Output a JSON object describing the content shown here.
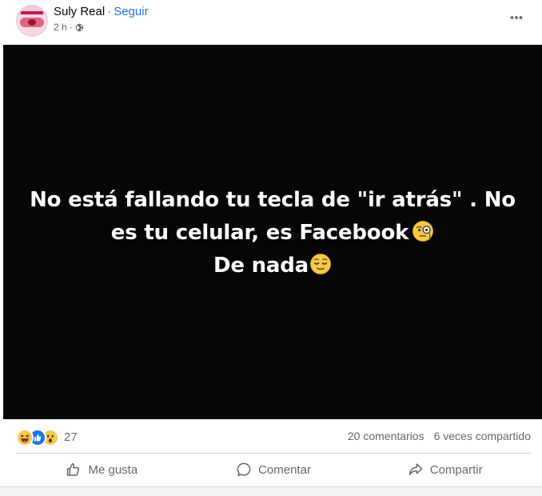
{
  "post": {
    "author": "Suly Real",
    "separator": "·",
    "follow_label": "Seguir",
    "time": "2 h",
    "meta_separator": "·",
    "visibility_icon": "globe-icon",
    "more_icon": "more-options-icon"
  },
  "image_text": {
    "line1": "No está fallando tu tecla de \"ir atrás\" . No",
    "line2": "es tu celular, es Facebook",
    "line2_emoji": "face-with-monocle-emoji",
    "line3": "De nada",
    "line3_emoji": "relieved-face-emoji"
  },
  "stats": {
    "reaction_icons": [
      "haha-reaction-icon",
      "like-reaction-icon",
      "wow-reaction-icon"
    ],
    "reaction_count": "27",
    "comments": "20 comentarios",
    "shares": "6 veces compartido"
  },
  "actions": {
    "like_label": "Me gusta",
    "comment_label": "Comentar",
    "share_label": "Compartir"
  },
  "colors": {
    "link": "#216fdb",
    "muted": "#65676b",
    "image_background": "#060606",
    "like_blue": "#1877f2",
    "reaction_yellow": "#f7c84a"
  }
}
